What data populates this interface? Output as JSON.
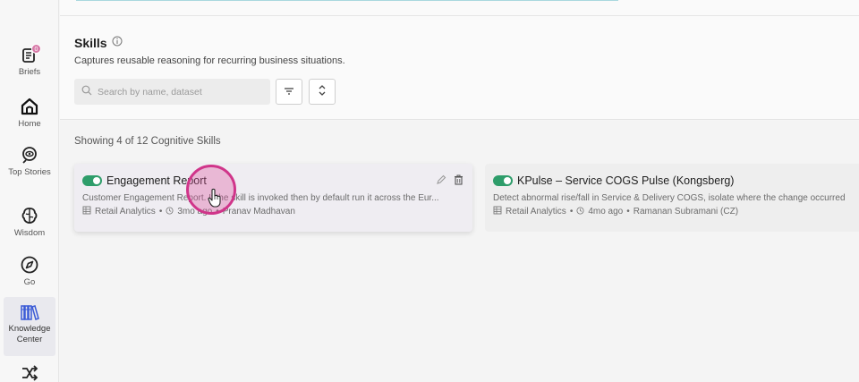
{
  "sidebar": {
    "items": [
      {
        "label": "Briefs",
        "icon": "briefs-icon",
        "badge": "0"
      },
      {
        "label": "Home",
        "icon": "home-icon"
      },
      {
        "label": "Top Stories",
        "icon": "top-stories-icon"
      },
      {
        "label": "Wisdom",
        "icon": "brain-icon"
      },
      {
        "label": "Go",
        "icon": "compass-icon"
      },
      {
        "label": "Knowledge Center",
        "icon": "books-icon",
        "active": true
      },
      {
        "label": "",
        "icon": "shuffle-icon"
      }
    ]
  },
  "header": {
    "title": "Skills",
    "subtitle": "Captures reusable reasoning for recurring business situations.",
    "search_placeholder": "Search by name, dataset"
  },
  "content": {
    "count_text": "Showing 4 of 12 Cognitive Skills",
    "cards": [
      {
        "title": "Engagement Report",
        "description": "Customer Engagement Report. If the skill is invoked then by default run it across the Eur...",
        "dataset": "Retail Analytics",
        "age": "3mo ago",
        "author": "Pranav Madhavan",
        "enabled": true
      },
      {
        "title": "KPulse – Service COGS Pulse (Kongsberg)",
        "description": "Detect abnormal rise/fall in Service & Delivery COGS, isolate where the change occurred",
        "dataset": "Retail Analytics",
        "age": "4mo ago",
        "author": "Ramanan Subramani (CZ)",
        "enabled": true
      }
    ]
  },
  "colors": {
    "toggle_on": "#2e9d6a",
    "cursor_highlight": "#d0358a",
    "badge": "#d77aa8"
  }
}
